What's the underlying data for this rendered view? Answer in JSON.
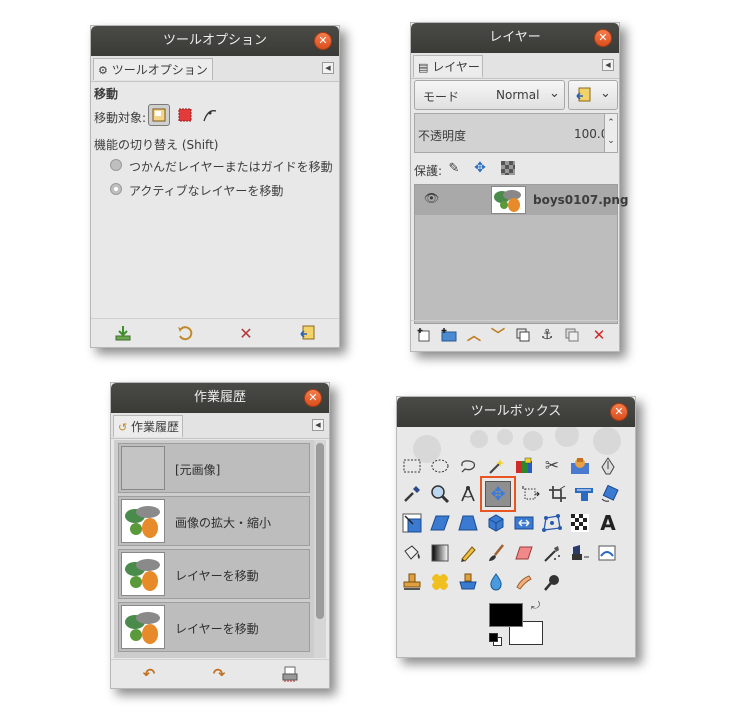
{
  "tool_options": {
    "title": "ツールオプション",
    "tab_label": "ツールオプション",
    "heading": "移動",
    "move_target_label": "移動対象:",
    "toggle_label": "機能の切り替え (Shift)",
    "radio_options": [
      "つかんだレイヤーまたはガイドを移動",
      "アクティブなレイヤーを移動"
    ],
    "selected_option": 1,
    "bottom_icons": [
      "save-options-icon",
      "restore-options-icon",
      "delete-options-icon",
      "reset-options-icon"
    ]
  },
  "layers": {
    "title": "レイヤー",
    "tab_label": "レイヤー",
    "mode_label": "モード",
    "mode_value": "Normal",
    "opacity_label": "不透明度",
    "opacity_value": "100.0",
    "lock_label": "保護:",
    "layer_items": [
      {
        "name": "boys0107.png",
        "visible": true
      }
    ],
    "bottom_icons": [
      "new-layer-icon",
      "new-layer-group-icon",
      "raise-layer-icon",
      "lower-layer-icon",
      "duplicate-layer-icon",
      "anchor-layer-icon",
      "merge-layer-icon",
      "delete-layer-icon"
    ]
  },
  "history": {
    "title": "作業履歴",
    "tab_label": "作業履歴",
    "items": [
      "[元画像]",
      "画像の拡大・縮小",
      "レイヤーを移動",
      "レイヤーを移動"
    ],
    "bottom_icons": [
      "undo-icon",
      "redo-icon",
      "clear-history-icon"
    ]
  },
  "toolbox": {
    "title": "ツールボックス",
    "active_tool": "move-tool"
  },
  "colors": {
    "titlebar": "#3c3b37",
    "close": "#e95420",
    "active_tool_border": "#e95420",
    "foreground": "#000000",
    "background": "#ffffff"
  }
}
